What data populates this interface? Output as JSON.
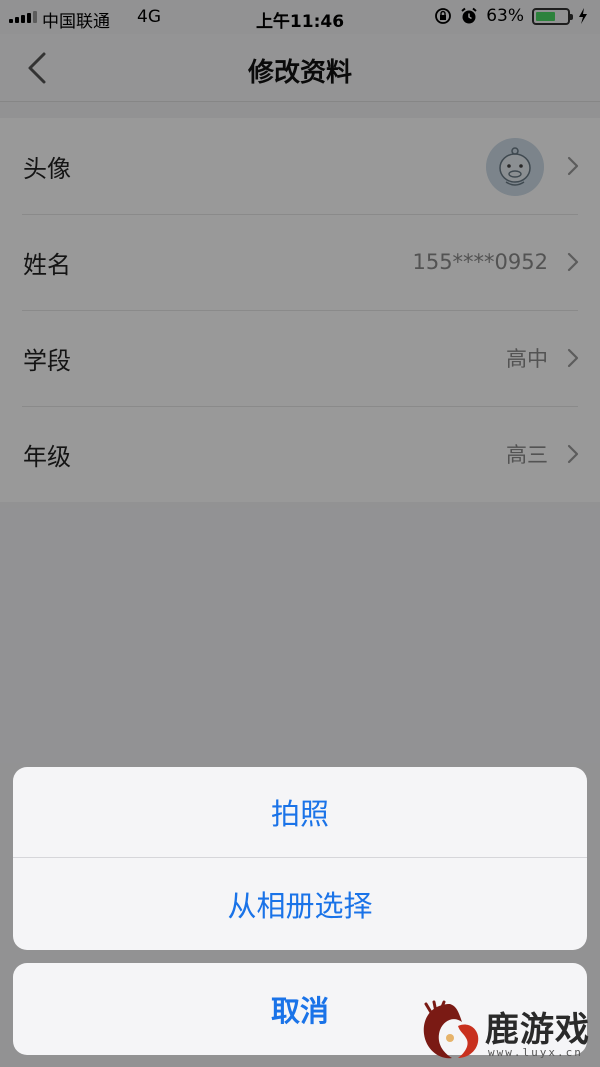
{
  "status_bar": {
    "carrier": "中国联通",
    "network": "4G",
    "time": "上午11:46",
    "battery_percent": "63%",
    "battery_level": 0.63,
    "icons": [
      "signal-icon",
      "orientation-lock-icon",
      "alarm-icon",
      "battery-icon",
      "charging-bolt-icon"
    ]
  },
  "nav": {
    "title": "修改资料",
    "back_icon": "chevron-left-icon"
  },
  "profile_rows": [
    {
      "label": "头像",
      "value": "",
      "kind": "avatar"
    },
    {
      "label": "姓名",
      "value": "155****0952"
    },
    {
      "label": "学段",
      "value": "高中"
    },
    {
      "label": "年级",
      "value": "高三"
    }
  ],
  "action_sheet": {
    "options": [
      "拍照",
      "从相册选择"
    ],
    "cancel": "取消"
  },
  "watermark": {
    "text": "鹿游戏",
    "url": "www.luyx.cn"
  },
  "colors": {
    "action_blue": "#1a73e8",
    "battery_green": "#4cd964",
    "overlay": "rgba(0,0,0,0.40)"
  }
}
